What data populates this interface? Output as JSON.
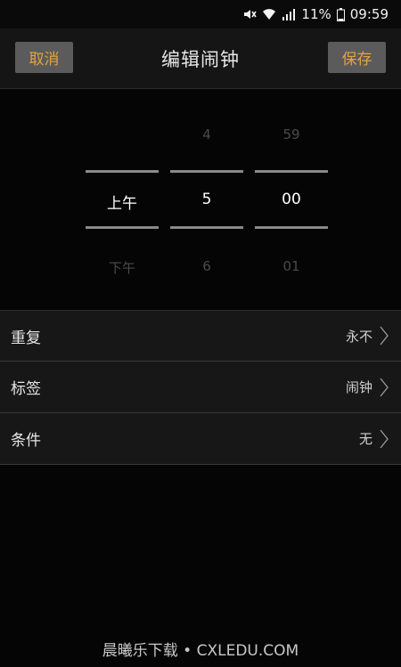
{
  "status_bar": {
    "battery": "11%",
    "time": "09:59",
    "icons": [
      "mute-icon",
      "wifi-icon",
      "signal-icon",
      "battery-icon"
    ]
  },
  "header": {
    "cancel_label": "取消",
    "title": "编辑闹钟",
    "save_label": "保存"
  },
  "picker": {
    "ampm": {
      "above": "",
      "selected": "上午",
      "below": "下午"
    },
    "hour": {
      "above": "4",
      "selected": "5",
      "below": "6"
    },
    "minute": {
      "above": "59",
      "selected": "00",
      "below": "01"
    }
  },
  "settings": [
    {
      "label": "重复",
      "value": "永不"
    },
    {
      "label": "标签",
      "value": "闹钟"
    },
    {
      "label": "条件",
      "value": "无"
    }
  ],
  "watermark": "晨曦乐下载 • CXLEDU.COM",
  "colors": {
    "accent": "#e0a53d",
    "button_bg": "#5b5b5b",
    "background": "#050505"
  }
}
